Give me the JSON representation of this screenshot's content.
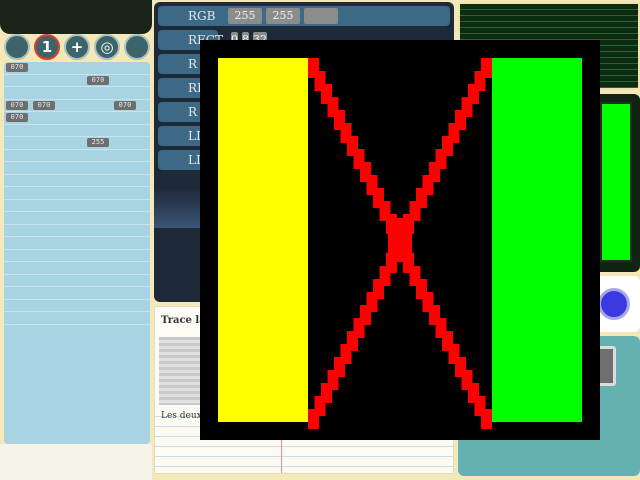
{
  "toolbar": {
    "buttons": [
      {
        "name": "tool-1",
        "label": ""
      },
      {
        "name": "tool-2",
        "label": "1"
      },
      {
        "name": "tool-3",
        "label": "+"
      },
      {
        "name": "tool-4",
        "label": "◎"
      },
      {
        "name": "tool-5",
        "label": ""
      }
    ]
  },
  "grid": {
    "tags": [
      {
        "row": 0,
        "col": 0,
        "text": "070"
      },
      {
        "row": 1,
        "col": 3,
        "text": "070"
      },
      {
        "row": 3,
        "col": 0,
        "text": "070"
      },
      {
        "row": 3,
        "col": 1,
        "text": "070"
      },
      {
        "row": 3,
        "col": 4,
        "text": "070"
      },
      {
        "row": 4,
        "col": 0,
        "text": "070"
      },
      {
        "row": 6,
        "col": 3,
        "text": "255"
      }
    ]
  },
  "commands": [
    {
      "label": "RGB",
      "values": [
        "255",
        "255",
        ""
      ]
    },
    {
      "label": "RECT",
      "values": [
        "",
        "0",
        "8",
        "32"
      ]
    },
    {
      "label": "R",
      "values": []
    },
    {
      "label": "RE",
      "values": []
    },
    {
      "label": "R",
      "values": []
    },
    {
      "label": "LI",
      "values": []
    },
    {
      "label": "LI",
      "values": []
    }
  ],
  "text_panel": {
    "title": "Trace la",
    "note": "Les deux"
  },
  "colors": {
    "yellow": "#ffff00",
    "green": "#00ff00",
    "red": "#ff0000",
    "black": "#000000"
  }
}
